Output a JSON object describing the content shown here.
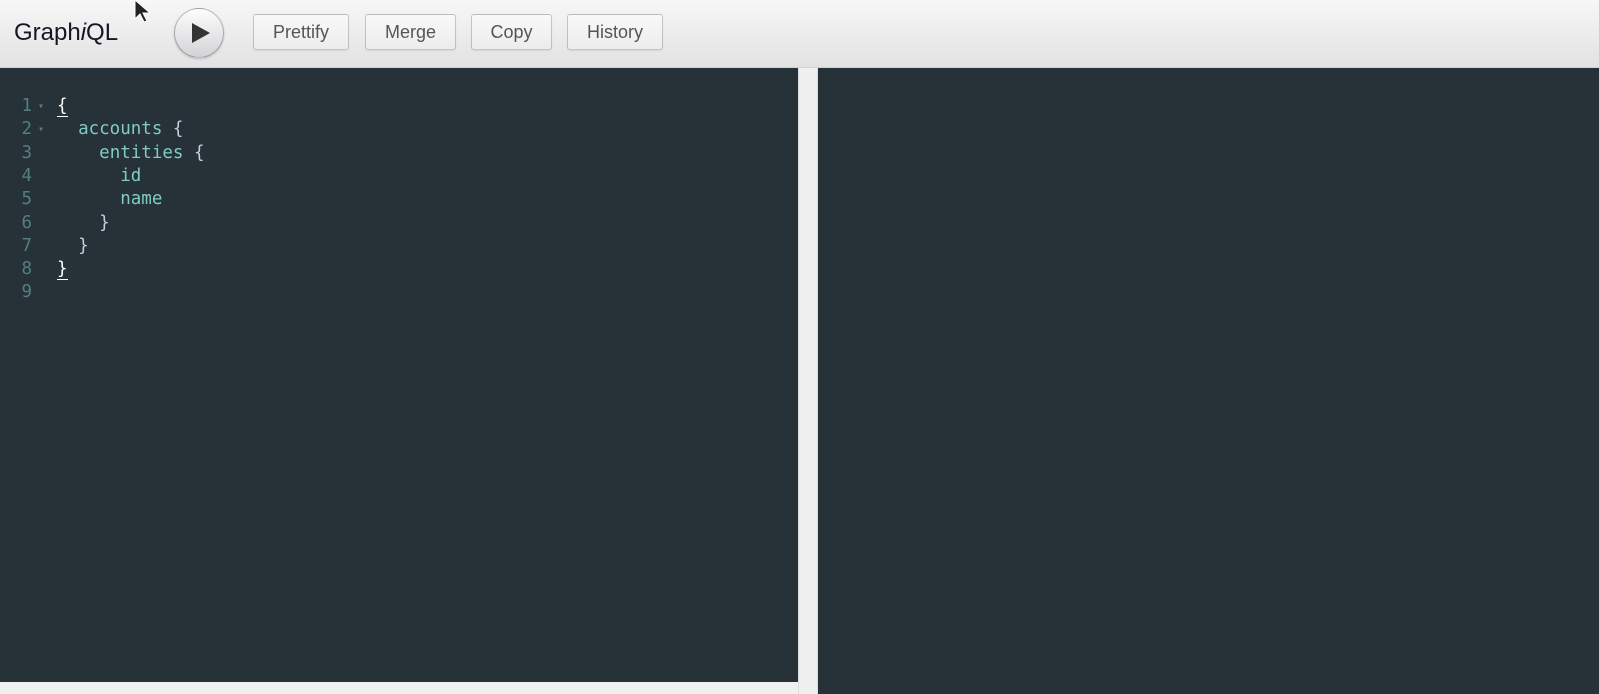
{
  "app": {
    "title_prefix": "Graph",
    "title_italic": "i",
    "title_suffix": "QL"
  },
  "toolbar": {
    "execute_icon": "play-icon",
    "buttons": [
      {
        "label": "Prettify"
      },
      {
        "label": "Merge"
      },
      {
        "label": "Copy"
      },
      {
        "label": "History"
      }
    ]
  },
  "editor": {
    "lines": [
      {
        "no": "1",
        "fold": "▾",
        "tokens": [
          {
            "t": "punc-hl",
            "v": "{"
          }
        ]
      },
      {
        "no": "2",
        "fold": "▾",
        "tokens": [
          {
            "t": "ws",
            "v": "  "
          },
          {
            "t": "field",
            "v": "accounts"
          },
          {
            "t": "punc",
            "v": " {"
          }
        ]
      },
      {
        "no": "3",
        "fold": "",
        "tokens": [
          {
            "t": "ws",
            "v": "    "
          },
          {
            "t": "field",
            "v": "entities"
          },
          {
            "t": "punc",
            "v": " {"
          }
        ]
      },
      {
        "no": "4",
        "fold": "",
        "tokens": [
          {
            "t": "ws",
            "v": "      "
          },
          {
            "t": "field",
            "v": "id"
          }
        ]
      },
      {
        "no": "5",
        "fold": "",
        "tokens": [
          {
            "t": "ws",
            "v": "      "
          },
          {
            "t": "field",
            "v": "name"
          }
        ]
      },
      {
        "no": "6",
        "fold": "",
        "tokens": [
          {
            "t": "ws",
            "v": "    "
          },
          {
            "t": "punc",
            "v": "}"
          }
        ]
      },
      {
        "no": "7",
        "fold": "",
        "tokens": [
          {
            "t": "ws",
            "v": "  "
          },
          {
            "t": "punc",
            "v": "}"
          }
        ]
      },
      {
        "no": "8",
        "fold": "",
        "tokens": [
          {
            "t": "punc-hl",
            "v": "}"
          }
        ]
      },
      {
        "no": "9",
        "fold": "",
        "tokens": []
      }
    ]
  },
  "result": {
    "text": ""
  },
  "colors": {
    "editor_bg": "#263238",
    "field": "#80cbc4",
    "punctuation": "#c3cee3",
    "line_number": "#537f7e"
  }
}
